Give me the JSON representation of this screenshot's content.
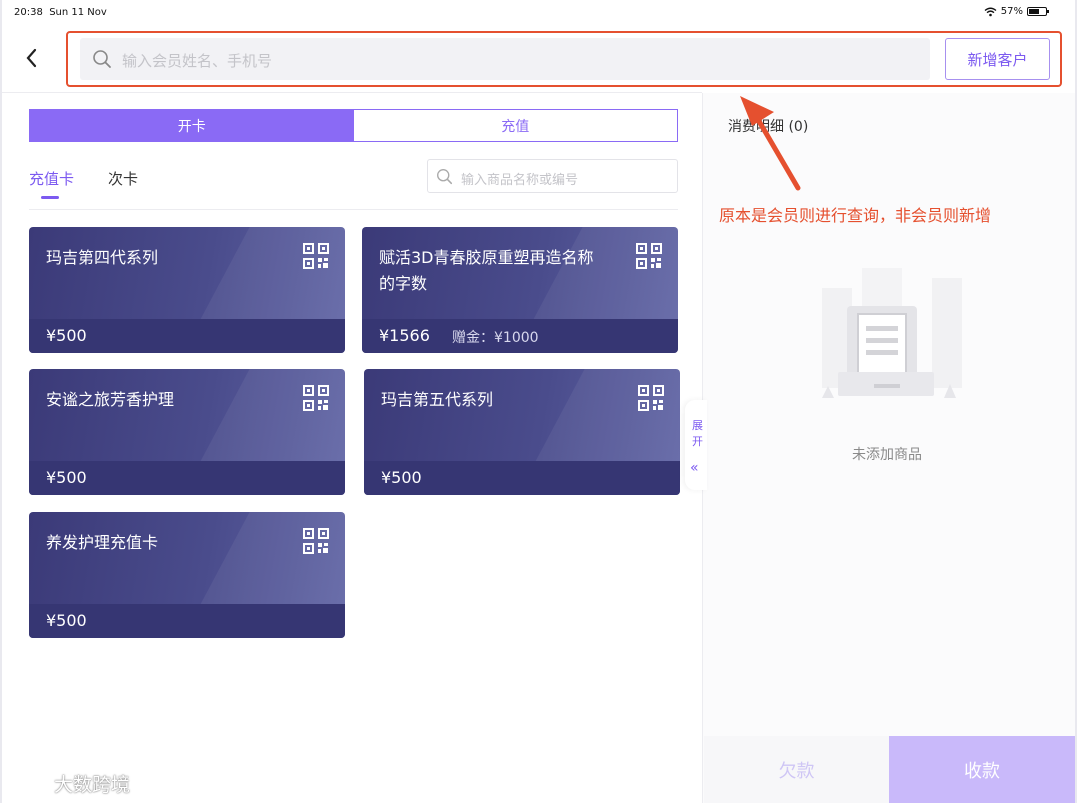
{
  "status_bar": {
    "time": "20:38",
    "date": "Sun 11 Nov",
    "battery": "57%"
  },
  "header": {
    "search_placeholder": "输入会员姓名、手机号",
    "add_customer_label": "新增客户"
  },
  "segments": {
    "open_card": "开卡",
    "recharge": "充值"
  },
  "sub_tabs": {
    "stored_value": "充值卡",
    "times_card": "次卡"
  },
  "goods_search_placeholder": "输入商品名称或编号",
  "cards": [
    {
      "name": "玛吉第四代系列",
      "price": "¥500",
      "gift": ""
    },
    {
      "name": "赋活3D青春胶原重塑再造名称的字数",
      "price": "¥1566",
      "gift": "赠金：¥1000"
    },
    {
      "name": "安谧之旅芳香护理",
      "price": "¥500",
      "gift": ""
    },
    {
      "name": "玛吉第五代系列",
      "price": "¥500",
      "gift": ""
    },
    {
      "name": "养发护理充值卡",
      "price": "¥500",
      "gift": ""
    }
  ],
  "expand_label": "展开",
  "right_panel": {
    "detail_title": "消费明细 (0)",
    "empty_text": "未添加商品",
    "debt_label": "欠款",
    "pay_label": "收款"
  },
  "annotation": "原本是会员则进行查询，非会员则新增",
  "watermark": "大数跨境",
  "colors": {
    "accent": "#8a6af5",
    "annotation": "#e5502f",
    "card": "#3b3a78"
  }
}
